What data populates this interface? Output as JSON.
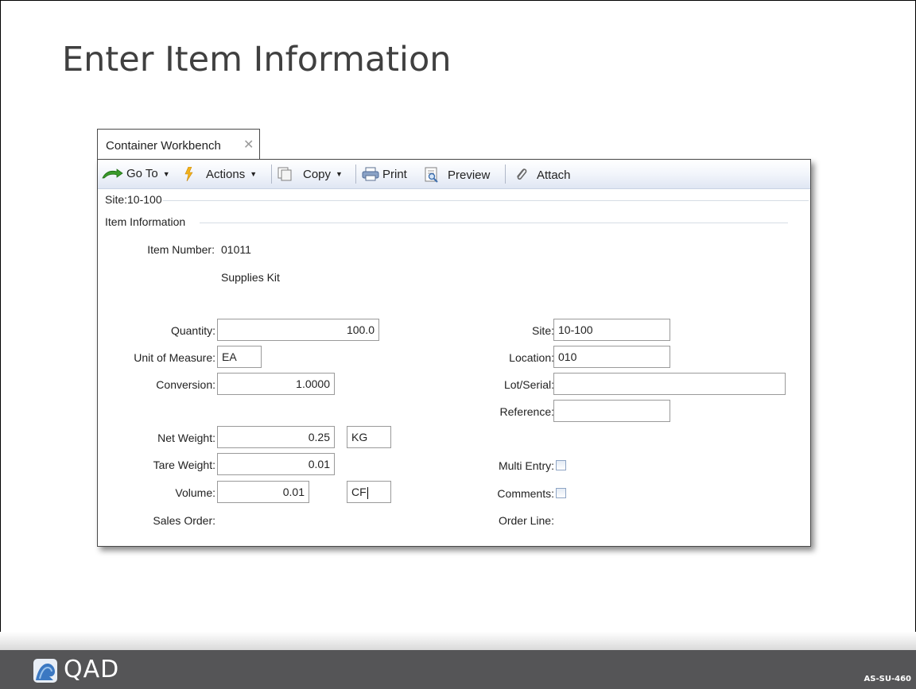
{
  "slide": {
    "title": "Enter Item Information",
    "brand": "QAD",
    "course_code": "AS-SU-460"
  },
  "tab": {
    "label": "Container Workbench",
    "close_glyph": "✕"
  },
  "toolbar": {
    "goto_label": "Go To",
    "actions_label": "Actions",
    "copy_label": "Copy",
    "print_label": "Print",
    "preview_label": "Preview",
    "attach_label": "Attach"
  },
  "header": {
    "site_caption": "Site:10-100",
    "section_label": "Item Information"
  },
  "item": {
    "number_label": "Item Number:",
    "number_value": "01011",
    "description": "Supplies Kit"
  },
  "left_fields": {
    "quantity_label": "Quantity:",
    "quantity_value": "100.0",
    "uom_label": "Unit of Measure:",
    "uom_value": "EA",
    "conversion_label": "Conversion:",
    "conversion_value": "1.0000",
    "net_weight_label": "Net Weight:",
    "net_weight_value": "0.25",
    "net_weight_unit": "KG",
    "tare_weight_label": "Tare Weight:",
    "tare_weight_value": "0.01",
    "volume_label": "Volume:",
    "volume_value": "0.01",
    "volume_unit": "CF",
    "sales_order_label": "Sales Order:"
  },
  "right_fields": {
    "site_label": "Site:",
    "site_value": "10-100",
    "location_label": "Location:",
    "location_value": "010",
    "lot_serial_label": "Lot/Serial:",
    "lot_serial_value": "",
    "reference_label": "Reference:",
    "reference_value": "",
    "multi_entry_label": "Multi Entry:",
    "multi_entry_checked": false,
    "comments_label": "Comments:",
    "comments_checked": false,
    "order_line_label": "Order Line:"
  },
  "icons": {
    "goto": "green-arrow-icon",
    "actions": "lightning-icon",
    "copy": "copy-icon",
    "print": "printer-icon",
    "preview": "preview-icon",
    "attach": "paperclip-icon"
  }
}
